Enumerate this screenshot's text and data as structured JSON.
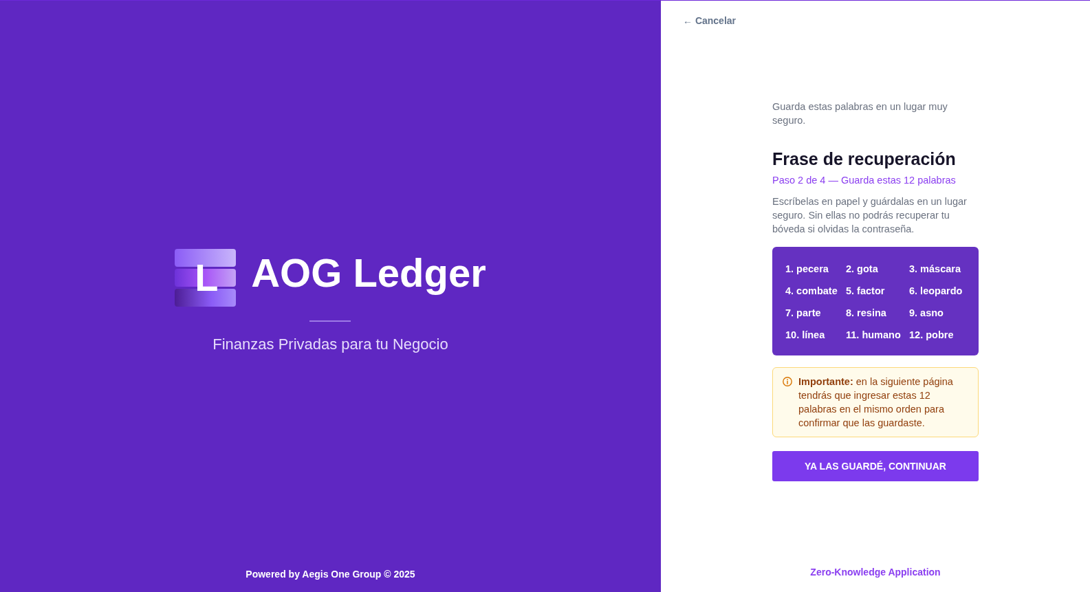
{
  "brand": {
    "logo_letter": "L",
    "name": "AOG Ledger",
    "tagline": "Finanzas Privadas para tu Negocio",
    "footer": "Powered by Aegis One Group © 2025"
  },
  "cancel_link": "← Cancelar",
  "intro": "Guarda estas palabras en un lugar muy seguro.",
  "title": "Frase de recuperación",
  "step": "Paso 2 de 4 — Guarda estas 12 palabras",
  "description": "Escríbelas en papel y guárdalas en un lugar seguro. Sin ellas no podrás recuperar tu bóveda si olvidas la contraseña.",
  "recovery_words": [
    "1. pecera",
    "2. gota",
    "3. máscara",
    "4. combate",
    "5. factor",
    "6. leopardo",
    "7. parte",
    "8. resina",
    "9. asno",
    "10. línea",
    "11. humano",
    "12. pobre"
  ],
  "notice": "**Importante:** en la siguiente página tendrás que ingresar estas 12 palabras en el mismo orden para confirmar que las guardaste.",
  "continue_button": "YA LAS GUARDÉ, CONTINUAR",
  "footer": "Zero-Knowledge Application"
}
